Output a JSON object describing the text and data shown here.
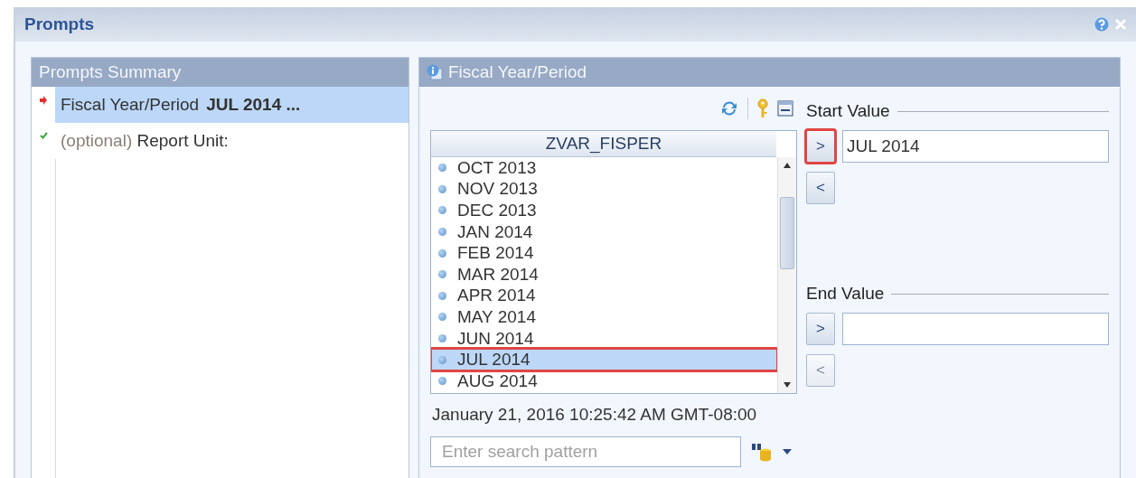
{
  "window": {
    "title": "Prompts"
  },
  "summary": {
    "title": "Prompts Summary",
    "items": [
      {
        "kind": "required",
        "label": "Fiscal Year/Period",
        "value": "JUL 2014 ...",
        "selected": true
      },
      {
        "kind": "optional",
        "prefix": "(optional)",
        "label": "Report Unit:",
        "selected": false
      }
    ]
  },
  "prompt": {
    "title": "Fiscal Year/Period",
    "list": {
      "column": "ZVAR_FISPER",
      "items": [
        {
          "label": "OCT 2013",
          "selected": false,
          "highlighted": false
        },
        {
          "label": "NOV 2013",
          "selected": false,
          "highlighted": false
        },
        {
          "label": "DEC 2013",
          "selected": false,
          "highlighted": false
        },
        {
          "label": "JAN 2014",
          "selected": false,
          "highlighted": false
        },
        {
          "label": "FEB 2014",
          "selected": false,
          "highlighted": false
        },
        {
          "label": "MAR 2014",
          "selected": false,
          "highlighted": false
        },
        {
          "label": "APR 2014",
          "selected": false,
          "highlighted": false
        },
        {
          "label": "MAY 2014",
          "selected": false,
          "highlighted": false
        },
        {
          "label": "JUN 2014",
          "selected": false,
          "highlighted": false
        },
        {
          "label": "JUL 2014",
          "selected": true,
          "highlighted": true
        },
        {
          "label": "AUG 2014",
          "selected": false,
          "highlighted": false
        }
      ]
    },
    "timestamp": "January 21, 2016 10:25:42 AM GMT-08:00",
    "search": {
      "placeholder": "Enter search pattern"
    },
    "ranges": [
      {
        "title": "Start Value",
        "value": "JUL 2014",
        "add": {
          "label": ">",
          "disabled": false,
          "highlighted": true
        },
        "remove": {
          "label": "<",
          "disabled": false,
          "highlighted": false
        }
      },
      {
        "title": "End Value",
        "add": {
          "label": ">",
          "disabled": false,
          "highlighted": false
        },
        "remove": {
          "label": "<",
          "disabled": true,
          "highlighted": false
        }
      }
    ]
  }
}
